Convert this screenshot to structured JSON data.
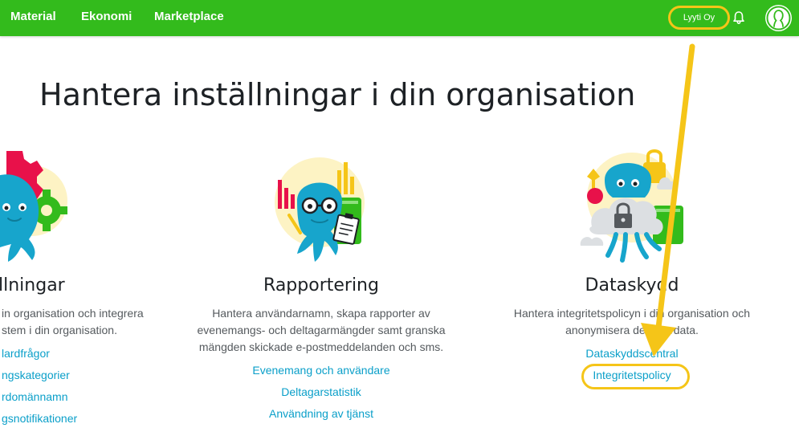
{
  "header": {
    "nav": [
      "Material",
      "Ekonomi",
      "Marketplace"
    ],
    "org_button": "Lyyti Oy",
    "colors": {
      "bar": "#33bb1c",
      "highlight": "#f5c518"
    }
  },
  "page_title": "Hantera inställningar i din organisation",
  "cards": [
    {
      "title": "llningar",
      "desc": [
        "in organisation och integrera",
        "stem i din organisation."
      ],
      "links": [
        "lardfrågor",
        "ngskategorier",
        "rdomännamn",
        "gsnotifikationer"
      ]
    },
    {
      "title": "Rapportering",
      "desc": [
        "Hantera användarnamn, skapa rapporter av",
        "evenemangs- och deltagarmängder samt granska",
        "mängden skickade e-postmeddelanden och sms."
      ],
      "links": [
        "Evenemang och användare",
        "Deltagarstatistik",
        "Användning av tjänst"
      ]
    },
    {
      "title": "Dataskydd",
      "desc": [
        "Hantera integritetspolicyn i din organisation och",
        "anonymisera deltagardata."
      ],
      "links": [
        "Dataskyddscentral",
        "Integritetspolicy"
      ]
    }
  ],
  "icons": {
    "notifications": "bell-icon",
    "user": "avatar-icon"
  }
}
